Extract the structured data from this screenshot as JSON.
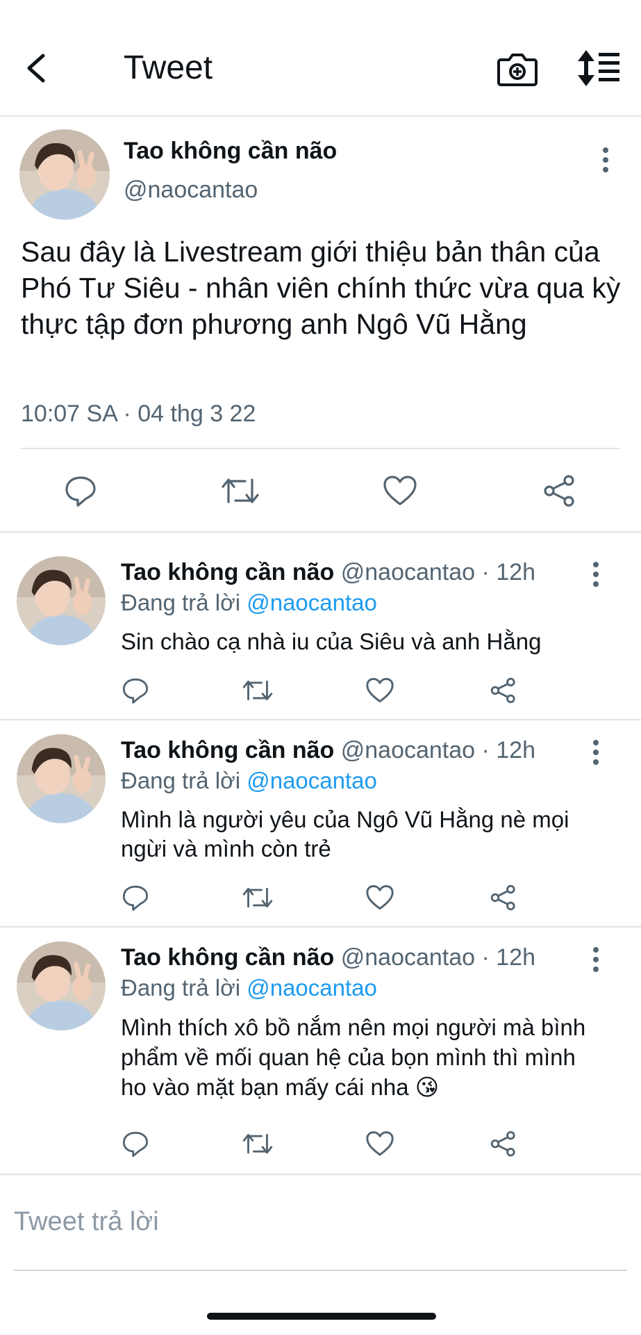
{
  "header": {
    "title": "Tweet",
    "back_icon": "chevron-left-icon",
    "camera_icon": "camera-icon",
    "sort_icon": "sort-icon"
  },
  "main_tweet": {
    "author_name": "Tao không cần não",
    "handle": "@naocantao",
    "text": "Sau đây là Livestream giới thiệu bản thân của Phó Tư Siêu - nhân viên chính thức vừa qua kỳ thực tập đơn phương anh Ngô Vũ Hằng",
    "timestamp": "10:07 SA · 04 thg 3 22",
    "actions": [
      "reply-icon",
      "retweet-icon",
      "like-icon",
      "share-icon"
    ]
  },
  "replies": [
    {
      "author_name": "Tao không cần não",
      "meta": "@naocantao · 12h",
      "replying_prefix": "Đang trả lời",
      "replying_to": "@naocantao",
      "text": "Sin chào cạ nhà iu của Siêu và anh Hằng"
    },
    {
      "author_name": "Tao không cần não",
      "meta": "@naocantao · 12h",
      "replying_prefix": "Đang trả lời",
      "replying_to": "@naocantao",
      "text": "Mình là người yêu của Ngô Vũ Hằng nè mọi ngừi và mình còn trẻ"
    },
    {
      "author_name": "Tao không cần não",
      "meta": "@naocantao · 12h",
      "replying_prefix": "Đang trả lời",
      "replying_to": "@naocantao",
      "text": "Mình thích xô bồ nắm nên mọi người mà bình phẩm về mối quan hệ của bọn mình thì mình ho vào mặt bạn mấy cái nha 😘"
    }
  ],
  "compose": {
    "placeholder": "Tweet trả lời"
  },
  "colors": {
    "text": "#0f1419",
    "secondary": "#536471",
    "mention": "#1d9bf0",
    "divider": "#e1e4e6"
  }
}
